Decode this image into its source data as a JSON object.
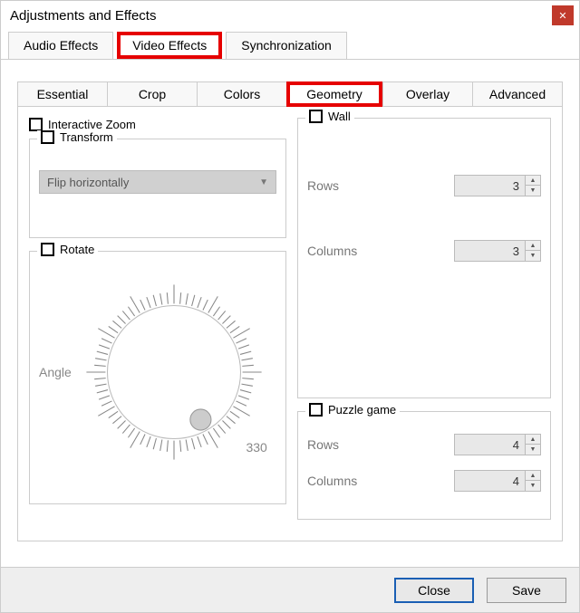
{
  "window": {
    "title": "Adjustments and Effects"
  },
  "mainTabs": {
    "audio": "Audio Effects",
    "video": "Video Effects",
    "sync": "Synchronization"
  },
  "subTabs": {
    "essential": "Essential",
    "crop": "Crop",
    "colors": "Colors",
    "geometry": "Geometry",
    "overlay": "Overlay",
    "advanced": "Advanced"
  },
  "geom": {
    "interactiveZoom": "Interactive Zoom",
    "transform": {
      "label": "Transform",
      "select": "Flip horizontally"
    },
    "rotate": {
      "label": "Rotate",
      "angle": "Angle",
      "tick": "330"
    },
    "wall": {
      "label": "Wall",
      "rowsLabel": "Rows",
      "rows": "3",
      "colsLabel": "Columns",
      "cols": "3"
    },
    "puzzle": {
      "label": "Puzzle game",
      "rowsLabel": "Rows",
      "rows": "4",
      "colsLabel": "Columns",
      "cols": "4"
    }
  },
  "footer": {
    "close": "Close",
    "save": "Save"
  }
}
